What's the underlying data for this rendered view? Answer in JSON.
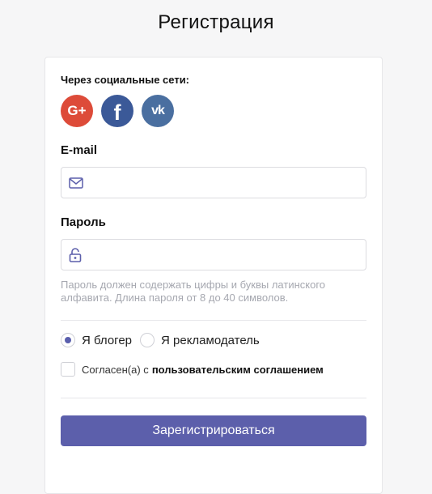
{
  "page": {
    "title": "Регистрация"
  },
  "social": {
    "label": "Через социальные сети:",
    "buttons": [
      {
        "name": "google-plus",
        "text": "G+",
        "color": "#dd4b39"
      },
      {
        "name": "facebook",
        "text": "f",
        "color": "#3b5998"
      },
      {
        "name": "vk",
        "text": "vk",
        "color": "#4a6fa0"
      }
    ]
  },
  "email": {
    "label": "E-mail",
    "value": "",
    "placeholder": "",
    "icon": "mail-icon"
  },
  "password": {
    "label": "Пароль",
    "value": "",
    "placeholder": "",
    "icon": "lock-icon",
    "hint": "Пароль должен содержать цифры и буквы латинского алфавита. Длина пароля от 8 до 40 символов."
  },
  "role": {
    "options": [
      {
        "label": "Я блогер",
        "selected": true
      },
      {
        "label": "Я рекламодатель",
        "selected": false
      }
    ]
  },
  "agreement": {
    "prefix": "Согласен(а) с",
    "link": "пользовательским соглашением",
    "checked": false
  },
  "submit": {
    "label": "Зарегистрироваться"
  },
  "colors": {
    "accent": "#5c5fab",
    "background": "#f6f6f7",
    "hint": "#a6a8b0"
  }
}
